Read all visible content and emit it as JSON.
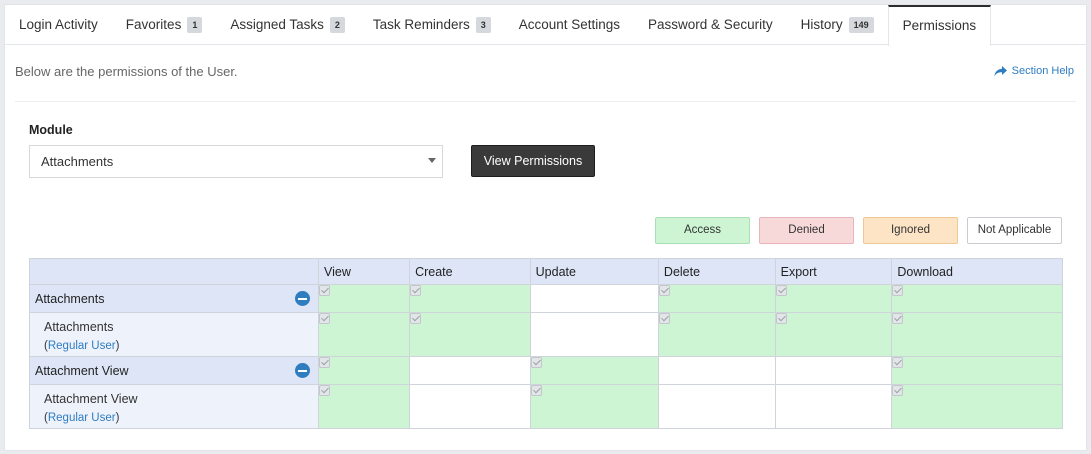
{
  "tabs": [
    {
      "label": "Login Activity",
      "badge": null
    },
    {
      "label": "Favorites",
      "badge": "1"
    },
    {
      "label": "Assigned Tasks",
      "badge": "2"
    },
    {
      "label": "Task Reminders",
      "badge": "3"
    },
    {
      "label": "Account Settings",
      "badge": null
    },
    {
      "label": "Password & Security",
      "badge": null
    },
    {
      "label": "History",
      "badge": "149"
    },
    {
      "label": "Permissions",
      "badge": null,
      "active": true
    }
  ],
  "intro": "Below are the permissions of the User.",
  "section_help": "Section Help",
  "module": {
    "label": "Module",
    "selected": "Attachments",
    "button": "View Permissions"
  },
  "legend": {
    "access": "Access",
    "denied": "Denied",
    "ignored": "Ignored",
    "not_applicable": "Not Applicable"
  },
  "colors": {
    "access": "#cdf5d3",
    "denied": "#f7d9da",
    "ignored": "#fce4c4",
    "not_applicable": "#ffffff",
    "header": "#dde5f6",
    "link": "#2f7cc1"
  },
  "table": {
    "columns": [
      "View",
      "Create",
      "Update",
      "Delete",
      "Export",
      "Download"
    ],
    "groups": [
      {
        "module": "Attachments",
        "cells": [
          "access",
          "access",
          "na",
          "access",
          "access",
          "access"
        ],
        "sub": {
          "name": "Attachments",
          "role": "Regular User",
          "cells": [
            "access",
            "access",
            "na",
            "access",
            "access",
            "access"
          ]
        }
      },
      {
        "module": "Attachment View",
        "cells": [
          "access",
          "na",
          "access",
          "na",
          "na",
          "access"
        ],
        "sub": {
          "name": "Attachment View",
          "role": "Regular User",
          "cells": [
            "access",
            "na",
            "access",
            "na",
            "na",
            "access"
          ]
        }
      }
    ]
  }
}
